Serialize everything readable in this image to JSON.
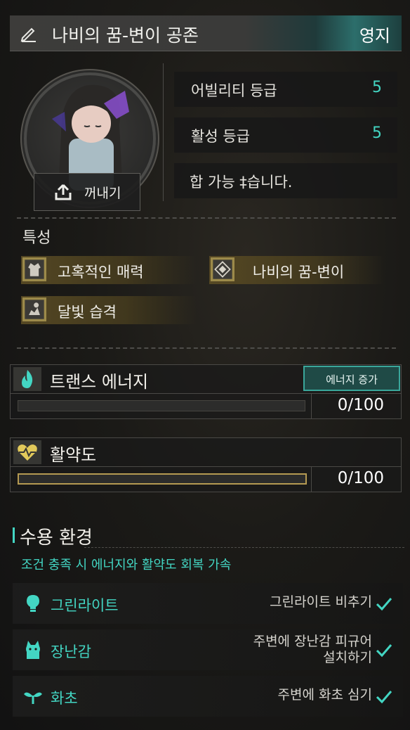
{
  "header": {
    "title": "나비의 꿈-변이 공존",
    "tag": "영지"
  },
  "portrait": {
    "extract_label": "꺼내기"
  },
  "stats": [
    {
      "label": "어빌리티 등급",
      "value": "5"
    },
    {
      "label": "활성 등급",
      "value": "5"
    }
  ],
  "notice": "합 가능 ‡습니다.",
  "traits": {
    "title": "특성",
    "items": [
      {
        "label": "고혹적인 매력",
        "icon": "coat-icon"
      },
      {
        "label": "나비의 꿈-변이",
        "icon": "diamond-icon"
      },
      {
        "label": "달빛 습격",
        "icon": "moon-strike-icon"
      }
    ]
  },
  "gauges": {
    "trance": {
      "label": "트랜스 에너지",
      "value": "0/100",
      "fill": 0,
      "button": "에너지 증가",
      "icon": "flame-icon"
    },
    "activity": {
      "label": "활약도",
      "value": "0/100",
      "fill": 0,
      "icon": "heartbeat-icon"
    }
  },
  "environment": {
    "title": "수용 환경",
    "subtitle": "조건 충족 시 에너지와 활약도 회복 가속",
    "items": [
      {
        "name": "그린라이트",
        "condition": "그린라이트 비추기",
        "icon": "lightbulb-icon",
        "met": true
      },
      {
        "name": "장난감",
        "condition_line1": "주변에 장난감 피규어",
        "condition_line2": "설치하기",
        "icon": "toy-icon",
        "met": true
      },
      {
        "name": "화초",
        "condition": "주변에 화초 심기",
        "icon": "sprout-icon",
        "met": true
      }
    ]
  },
  "colors": {
    "accent": "#43d6c3",
    "gold": "#9c8a4a"
  }
}
